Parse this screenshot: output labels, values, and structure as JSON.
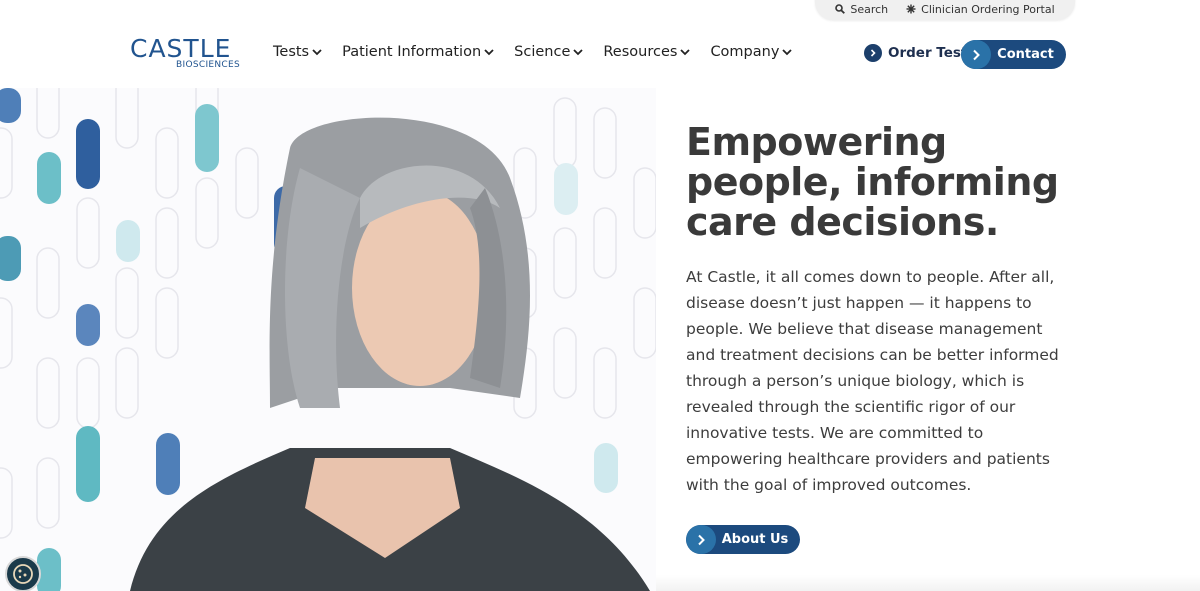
{
  "utility": {
    "search_label": "Search",
    "portal_label": "Clinician Ordering Portal",
    "search_icon": "search-icon",
    "portal_icon": "asterisk-icon"
  },
  "logo": {
    "main": "CASTLE",
    "sub": "BIOSCIENCES"
  },
  "nav": {
    "items": [
      {
        "label": "Tests"
      },
      {
        "label": "Patient Information"
      },
      {
        "label": "Science"
      },
      {
        "label": "Resources"
      },
      {
        "label": "Company"
      }
    ]
  },
  "header_actions": {
    "order_test_label": "Order Test",
    "contact_label": "Contact"
  },
  "hero": {
    "headline": "Empowering people, informing care decisions.",
    "body": "At Castle, it all comes down to people. After all, disease doesn’t just happen — it happens to people. We believe that disease management and treatment decisions can be better informed through a person’s unique biology, which is revealed through the scientific rigor of our innovative tests. We are committed to empowering healthcare providers and patients with the goal of improved outcomes.",
    "cta_label": "About Us"
  },
  "colors": {
    "brand_navy": "#1c4a7e",
    "brand_teal": "#2a72a8",
    "headline_gray": "#3a3a3a"
  },
  "cookie": {
    "icon": "cookie-icon"
  }
}
